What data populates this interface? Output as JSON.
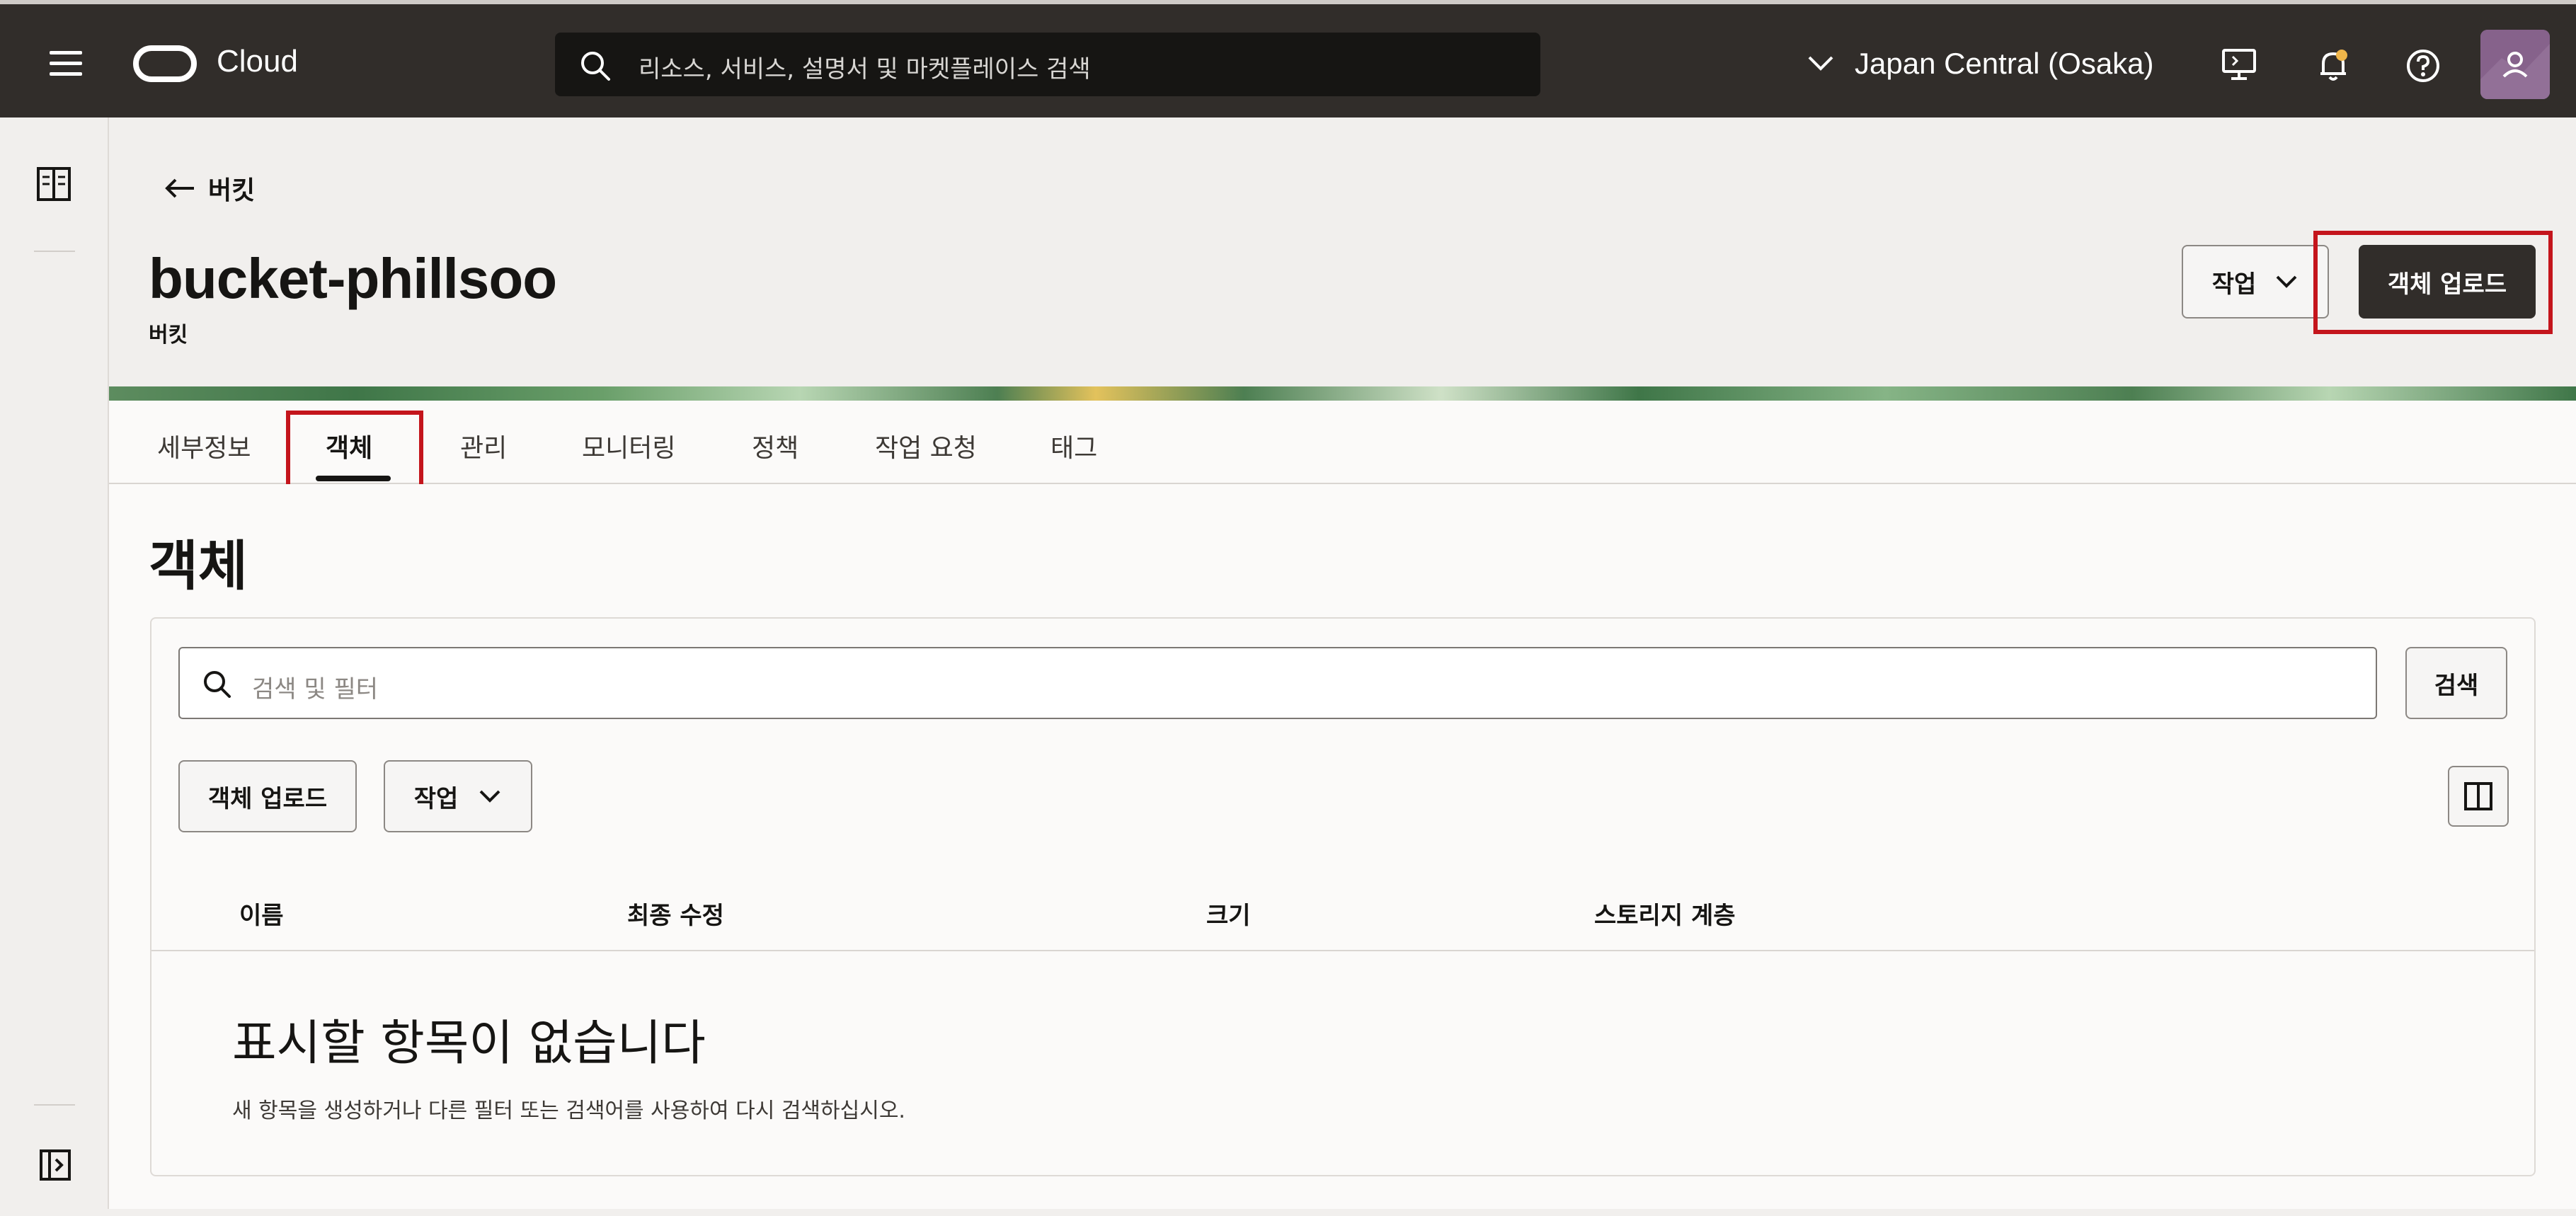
{
  "topbar": {
    "brand": "Cloud",
    "search_placeholder": "리소스, 서비스, 설명서 및 마켓플레이스 검색",
    "region": "Japan Central (Osaka)",
    "icons": [
      "menu-icon",
      "oracle-logo-icon",
      "search-icon",
      "chevron-down-icon",
      "cloud-shell-icon",
      "bell-icon",
      "help-icon",
      "user-avatar"
    ],
    "colors": {
      "bar": "#312d2a",
      "search": "#161513",
      "notification_dot": "#f0b64a"
    }
  },
  "left_rail": {
    "icons": [
      "dashboard-panel-icon",
      "expand-panel-icon"
    ]
  },
  "header": {
    "back_label": "버킷",
    "title": "bucket-phillsoo",
    "subtitle": "버킷",
    "actions_label": "작업",
    "upload_label": "객체 업로드"
  },
  "tabs": [
    {
      "label": "세부정보",
      "active": false
    },
    {
      "label": "객체",
      "active": true
    },
    {
      "label": "관리",
      "active": false
    },
    {
      "label": "모니터링",
      "active": false
    },
    {
      "label": "정책",
      "active": false
    },
    {
      "label": "작업 요청",
      "active": false
    },
    {
      "label": "태그",
      "active": false
    }
  ],
  "objects": {
    "section_title": "객체",
    "filter_placeholder": "검색 및 필터",
    "search_button": "검색",
    "upload_button": "객체 업로드",
    "actions_button": "작업",
    "columns": [
      "이름",
      "최종 수정",
      "크기",
      "스토리지 계층"
    ],
    "empty_title": "표시할 항목이 없습니다",
    "empty_description": "새 항목을 생성하거나 다른 필터 또는 검색어를 사용하여 다시 검색하십시오."
  },
  "highlight_color": "#c4151c"
}
